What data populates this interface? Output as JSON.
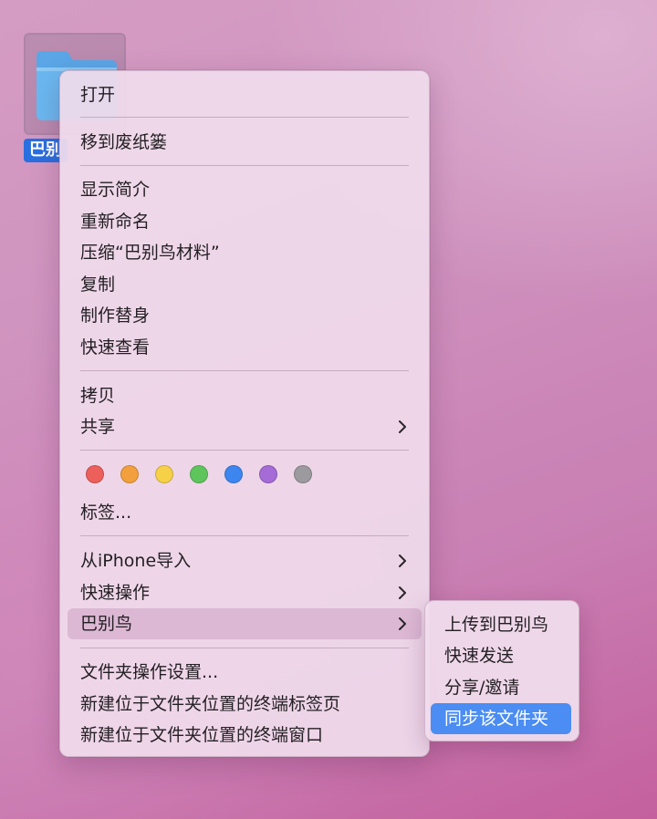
{
  "desktop": {
    "folder_label": "巴别鸟材料",
    "folder_label_visible": "巴别"
  },
  "menu": {
    "open": "打开",
    "trash": "移到废纸篓",
    "get_info": "显示简介",
    "rename": "重新命名",
    "compress": "压缩“巴别鸟材料”",
    "duplicate": "复制",
    "make_alias": "制作替身",
    "quick_look": "快速查看",
    "copy": "拷贝",
    "share": "共享",
    "tags_label": "标签...",
    "import_iphone": "从iPhone导入",
    "quick_actions": "快速操作",
    "babelbird": "巴别鸟",
    "folder_action_setup": "文件夹操作设置...",
    "new_terminal_tab": "新建位于文件夹位置的终端标签页",
    "new_terminal_window": "新建位于文件夹位置的终端窗口"
  },
  "tag_colors": [
    {
      "name": "red",
      "color": "#ec5f5b"
    },
    {
      "name": "orange",
      "color": "#f2a03d"
    },
    {
      "name": "yellow",
      "color": "#f6d047"
    },
    {
      "name": "green",
      "color": "#5ec55d"
    },
    {
      "name": "blue",
      "color": "#3d86f0"
    },
    {
      "name": "purple",
      "color": "#a56bd6"
    },
    {
      "name": "gray",
      "color": "#9c9a9e"
    }
  ],
  "submenu": {
    "upload": "上传到巴别鸟",
    "quick_send": "快速发送",
    "share_invite": "分享/邀请",
    "sync_folder": "同步该文件夹"
  },
  "colors": {
    "selection": "#4b8df2",
    "folder_label_bg": "#2a6fe0"
  }
}
